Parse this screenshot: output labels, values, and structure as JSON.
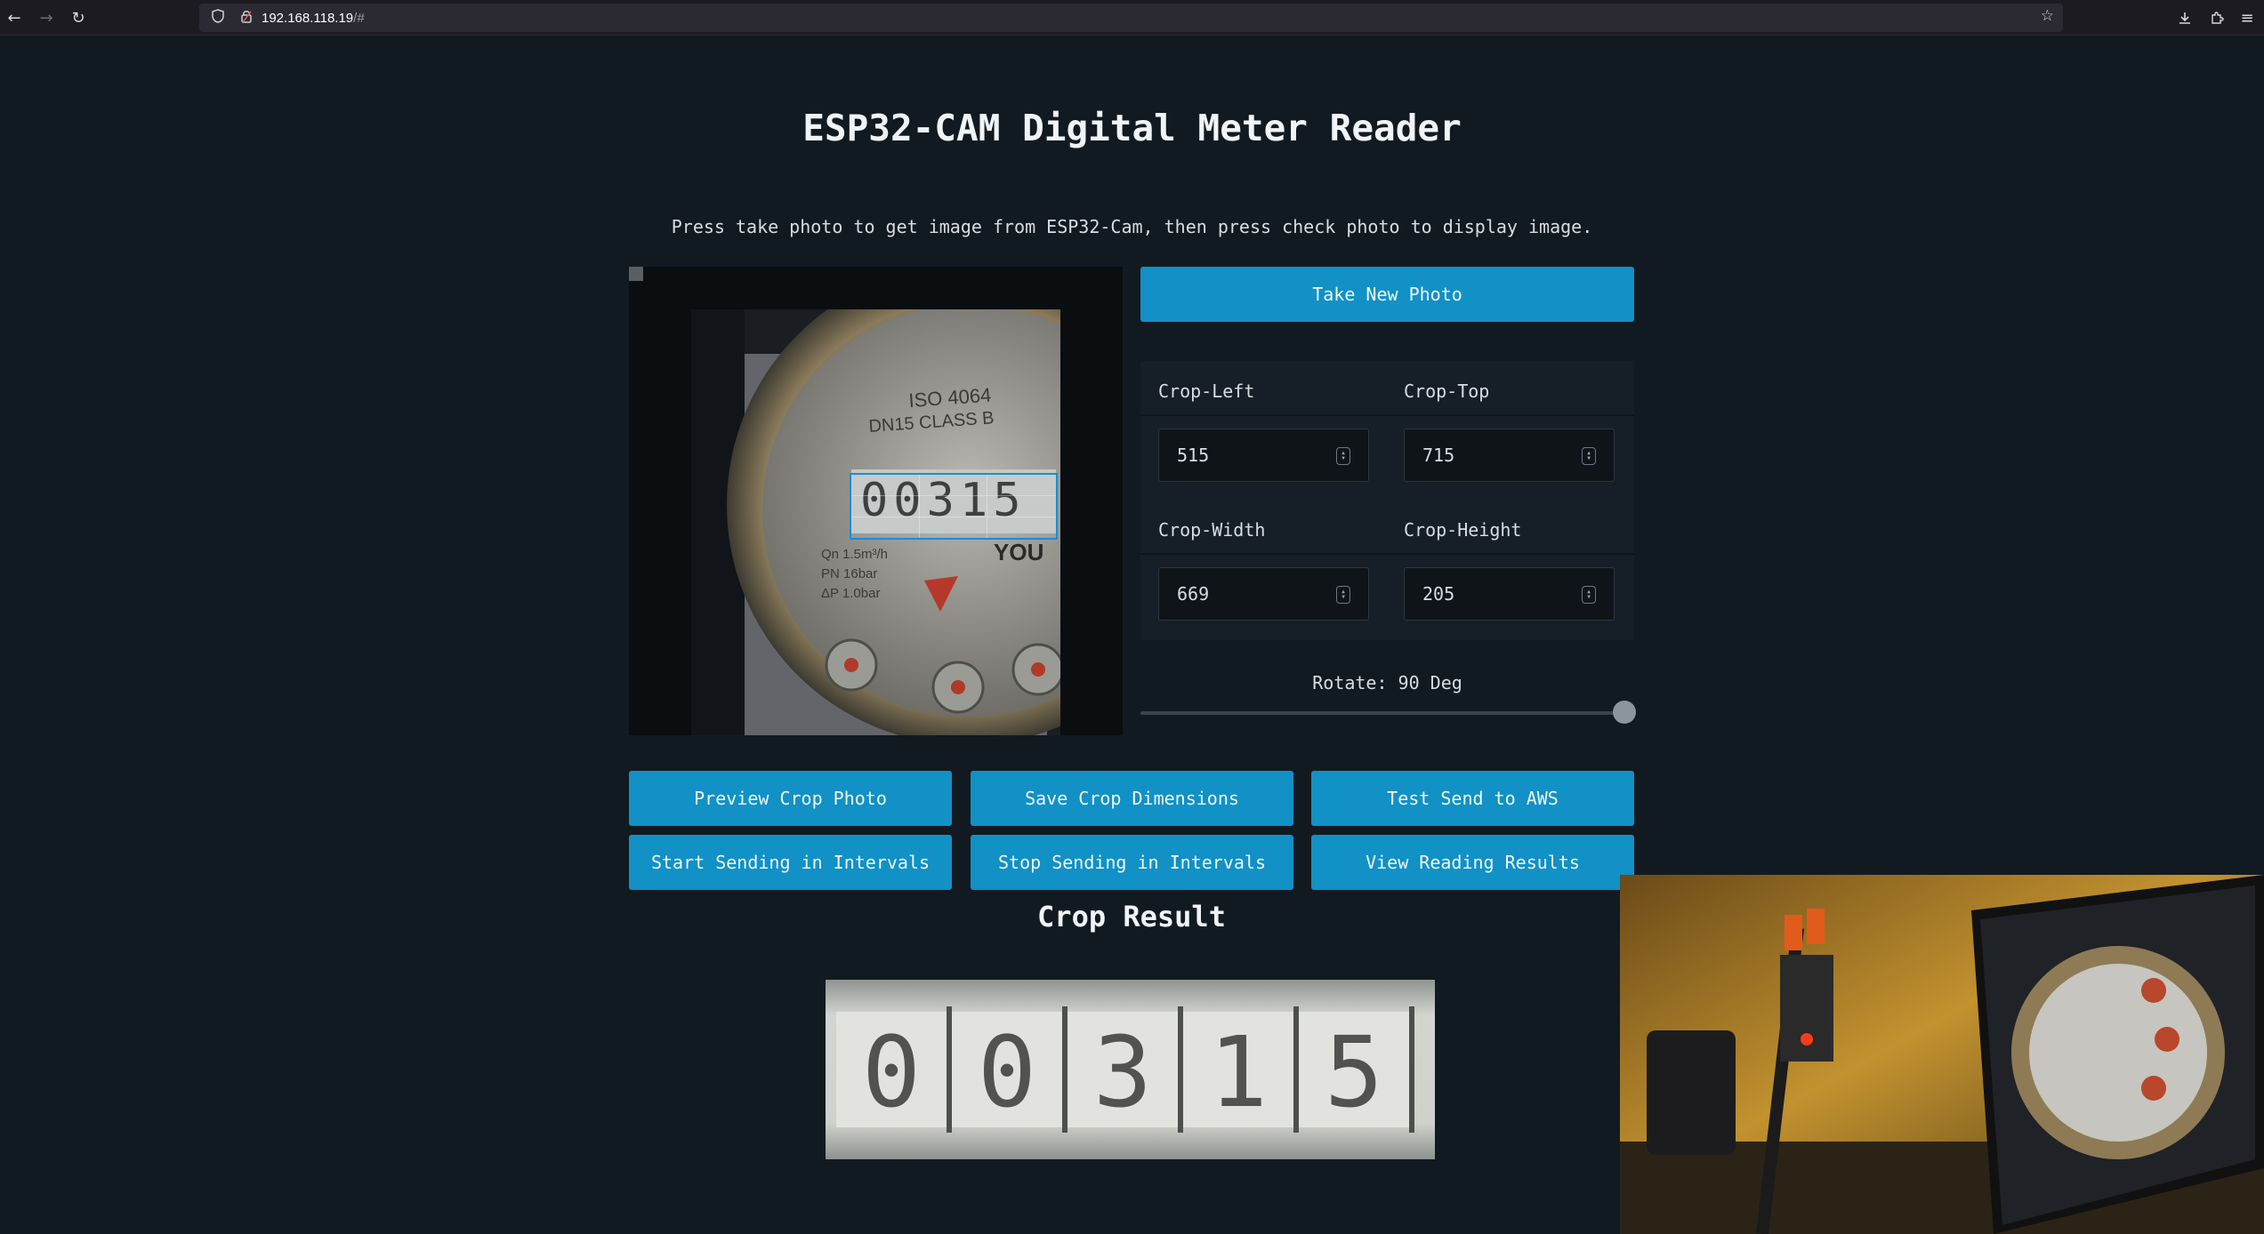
{
  "browser": {
    "url_host": "192.168.118.19",
    "url_rest": "/#",
    "back_icon": "arrow-left-icon",
    "forward_icon": "arrow-right-icon",
    "reload_icon": "reload-icon"
  },
  "page": {
    "title": "ESP32-CAM Digital Meter Reader",
    "instructions": "Press take photo to get image from ESP32-Cam, then press check photo to display image."
  },
  "camera": {
    "meter_text_top": "ISO 4064",
    "meter_text_class": "DN15 CLASS B",
    "meter_brand": "YOU",
    "meter_specs": [
      "Qn 1.5m³/h",
      "PN 16bar",
      "ΔP 1.0bar"
    ],
    "counter_digits": "00315"
  },
  "buttons": {
    "take_photo": "Take New Photo",
    "preview_crop": "Preview Crop Photo",
    "save_crop": "Save Crop Dimensions",
    "test_send": "Test Send to AWS",
    "start_sending": "Start Sending in Intervals",
    "stop_sending": "Stop Sending in Intervals",
    "view_results": "View Reading Results"
  },
  "crop": {
    "left_label": "Crop-Left",
    "left_value": "515",
    "top_label": "Crop-Top",
    "top_value": "715",
    "width_label": "Crop-Width",
    "width_value": "669",
    "height_label": "Crop-Height",
    "height_value": "205"
  },
  "rotate": {
    "label": "Rotate: 90 Deg",
    "value_deg": 90,
    "max_deg": 90
  },
  "result": {
    "title": "Crop Result",
    "digits": [
      "0",
      "0",
      "3",
      "1",
      "5"
    ]
  },
  "colors": {
    "background": "#121a21",
    "accent": "#1191c5",
    "panel": "#161f27"
  }
}
